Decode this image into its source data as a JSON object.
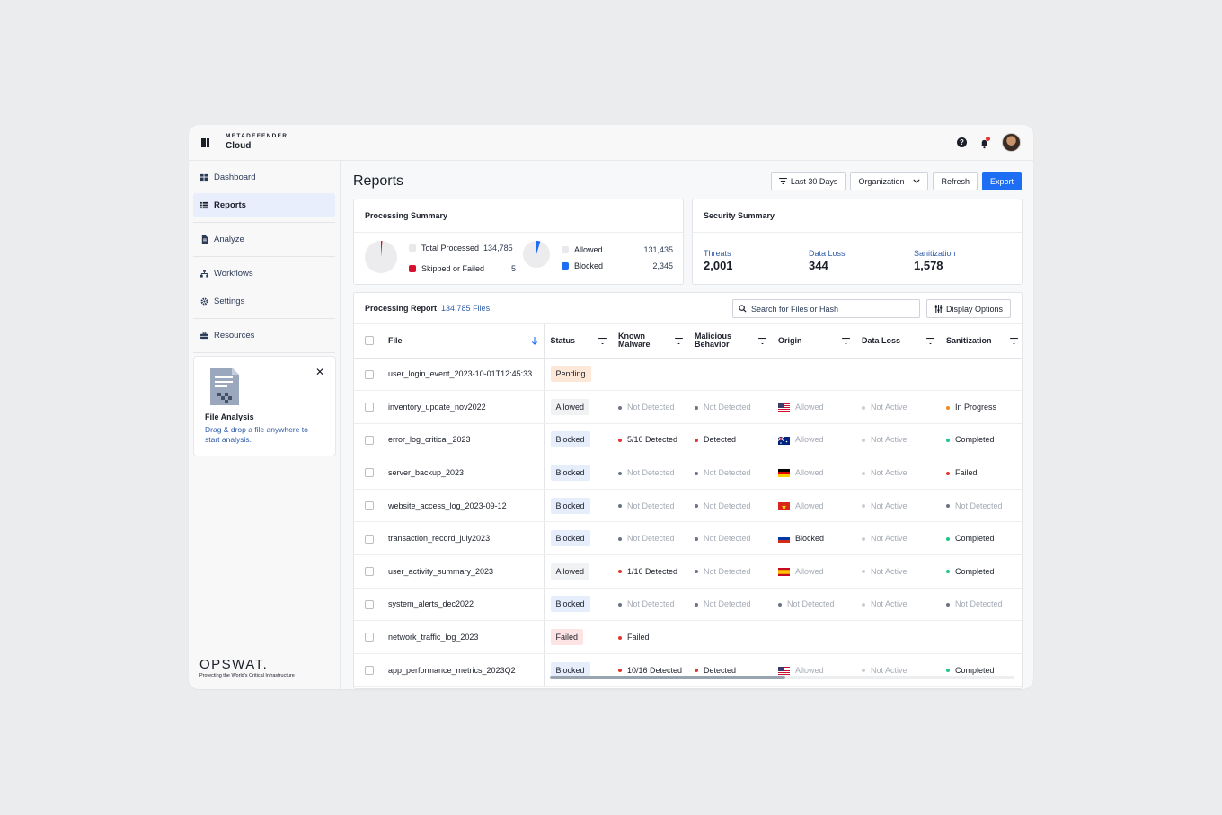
{
  "brand": {
    "top": "METADEFENDER",
    "bottom": "Cloud"
  },
  "topbar": {
    "help_icon": "question-icon",
    "bell_icon": "bell-icon",
    "avatar": "user-avatar"
  },
  "sidebar": {
    "items": [
      {
        "label": "Dashboard",
        "icon": "dashboard-icon"
      },
      {
        "label": "Reports",
        "icon": "list-icon",
        "active": true
      },
      {
        "label": "Analyze",
        "icon": "file-icon"
      },
      {
        "label": "Workflows",
        "icon": "workflow-icon"
      },
      {
        "label": "Settings",
        "icon": "gear-icon"
      },
      {
        "label": "Resources",
        "icon": "briefcase-icon"
      }
    ],
    "file_card": {
      "title": "File Analysis",
      "desc": "Drag & drop a file anywhere to start analysis."
    },
    "footer": {
      "name": "OPSWAT.",
      "tagline": "Protecting the World's Critical Infrastructure"
    }
  },
  "page": {
    "title": "Reports"
  },
  "actions": {
    "range": "Last 30 Days",
    "org": "Organization",
    "refresh": "Refresh",
    "export": "Export"
  },
  "processing_summary": {
    "title": "Processing Summary",
    "total_label": "Total Processed",
    "total_value": "134,785",
    "skipped_label": "Skipped or Failed",
    "skipped_value": "5",
    "allowed_label": "Allowed",
    "allowed_value": "131,435",
    "blocked_label": "Blocked",
    "blocked_value": "2,345"
  },
  "security_summary": {
    "title": "Security Summary",
    "metrics": [
      {
        "label": "Threats",
        "value": "2,001"
      },
      {
        "label": "Data Loss",
        "value": "344"
      },
      {
        "label": "Sanitization",
        "value": "1,578"
      }
    ]
  },
  "report": {
    "title": "Processing Report",
    "count": "134,785 Files",
    "search_placeholder": "Search for Files or Hash",
    "display_options": "Display Options",
    "columns": [
      "File",
      "Status",
      "Known Malware",
      "Malicious Behavior",
      "Origin",
      "Data Loss",
      "Sanitization"
    ],
    "rows": [
      {
        "file": "user_login_event_2023-10-01T12:45:33",
        "status": "Pending",
        "malware": "",
        "behavior": "",
        "origin": "",
        "flag": "",
        "dataloss": "",
        "sanitization": ""
      },
      {
        "file": "inventory_update_nov2022",
        "status": "Allowed",
        "malware": "Not Detected",
        "behavior": "Not Detected",
        "origin": "Allowed",
        "flag": "us",
        "dataloss": "Not Active",
        "sanitization": "In Progress"
      },
      {
        "file": "error_log_critical_2023",
        "status": "Blocked",
        "malware": "5/16 Detected",
        "behavior": "Detected",
        "origin": "Allowed",
        "flag": "au",
        "dataloss": "Not Active",
        "sanitization": "Completed"
      },
      {
        "file": "server_backup_2023",
        "status": "Blocked",
        "malware": "Not Detected",
        "behavior": "Not Detected",
        "origin": "Allowed",
        "flag": "de",
        "dataloss": "Not Active",
        "sanitization": "Failed"
      },
      {
        "file": "website_access_log_2023-09-12",
        "status": "Blocked",
        "malware": "Not Detected",
        "behavior": "Not Detected",
        "origin": "Allowed",
        "flag": "vn",
        "dataloss": "Not Active",
        "sanitization": "Not Detected"
      },
      {
        "file": "transaction_record_july2023",
        "status": "Blocked",
        "malware": "Not Detected",
        "behavior": "Not Detected",
        "origin": "Blocked",
        "flag": "ru",
        "dataloss": "Not Active",
        "sanitization": "Completed"
      },
      {
        "file": "user_activity_summary_2023",
        "status": "Allowed",
        "malware": "1/16 Detected",
        "behavior": "Not Detected",
        "origin": "Allowed",
        "flag": "es",
        "dataloss": "Not Active",
        "sanitization": "Completed"
      },
      {
        "file": "system_alerts_dec2022",
        "status": "Blocked",
        "malware": "Not Detected",
        "behavior": "Not Detected",
        "origin": "Not Detected",
        "flag": "",
        "dataloss": "Not Active",
        "sanitization": "Not Detected"
      },
      {
        "file": "network_traffic_log_2023",
        "status": "Failed",
        "malware": "Failed",
        "behavior": "",
        "origin": "",
        "flag": "",
        "dataloss": "",
        "sanitization": ""
      },
      {
        "file": "app_performance_metrics_2023Q2",
        "status": "Blocked",
        "malware": "10/16 Detected",
        "behavior": "Detected",
        "origin": "Allowed",
        "flag": "us",
        "dataloss": "Not Active",
        "sanitization": "Completed"
      }
    ]
  },
  "colors": {
    "accent": "#1d6ef2",
    "danger": "#e3342f",
    "success": "#1fc68a",
    "warning": "#f08a24",
    "neutral": "#6b7486",
    "muted_dot": "#c9ced6"
  }
}
